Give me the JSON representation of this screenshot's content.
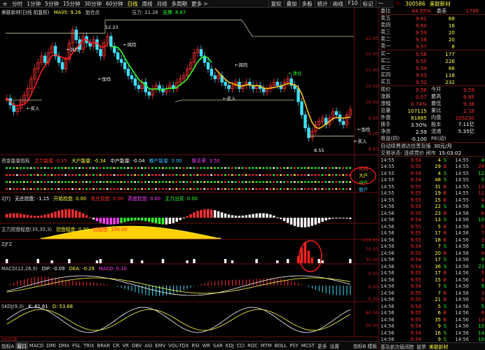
{
  "topbar": {
    "tabs": [
      "分时",
      "1分钟",
      "5分钟",
      "15分钟",
      "30分钟",
      "60分钟",
      "日线",
      "周线",
      "月线",
      "多周期",
      "更多 >"
    ],
    "selected": "日线",
    "right": [
      "复权",
      "叠加",
      "多股",
      "统计",
      "画线",
      "F10",
      "标记",
      "—"
    ],
    "icons": [
      "grid-icon",
      "lock-icon",
      "more-icon"
    ]
  },
  "stock": {
    "code": "300586",
    "name": "美联新材"
  },
  "main": {
    "title": "美联新材(日线 前复权)",
    "ma": "MA05: 9.26",
    "pressure": "压力: 11.26",
    "support": "支撑: 8.67",
    "addpoint": "加仓点",
    "price_labels": [
      "12.00",
      "11.50",
      "11.00",
      "10.50",
      "10.00",
      "9.50",
      "9.00",
      "8.50"
    ],
    "annotations": {
      "high": "12.23",
      "low": "8.55",
      "risk1": "←风险",
      "risk2": "←风险",
      "risk3": "←风险",
      "add1": "←加仓",
      "add2": "←加仓",
      "buy1": "←买入",
      "buy2": "←买入",
      "buy3": "←买入",
      "clear": "←清仓"
    }
  },
  "p1": {
    "title": "资金能量指标",
    "a": "主力能量: 0.15",
    "b": "大户能量: -0.34",
    "c": "中户能量: -0.04",
    "d": "散户能量: 0.00",
    "e": "换手率: 3.50",
    "labels": [
      "机构",
      "大户",
      "中户",
      "散户"
    ]
  },
  "p2": {
    "title": "ZJTJ",
    "a": "无庄控盘: -1.15",
    "b": "开始控盘: 0.00",
    "c": "有庄控盘: 0.00",
    "d": "高度控盘: 0.00",
    "e": "主力出货: 0.00"
  },
  "p3": {
    "title": "主力控盘程度(35,35,3)",
    "a": "控盘程度: 0.00",
    "b": "控盘度: 100.00",
    "axis": [
      "-150.00"
    ]
  },
  "p4": {
    "title": "ZJFZ",
    "axis": [
      "70.00",
      "35.00"
    ]
  },
  "p5": {
    "title": "MACD(12,26,9)",
    "a": "DIF: -0.09",
    "b": "DEA: -0.29",
    "c": "MACD: 0.10",
    "axis": [
      "0.50",
      "0.00",
      "-0.50"
    ]
  },
  "p6": {
    "title": "SKDJ(9,3)",
    "a": "K: 61.61",
    "b": "D: 53.68",
    "axis": [
      "80.00",
      "50.00"
    ]
  },
  "bottom": {
    "date": "2025年",
    "tabs": [
      "指标A",
      "窗口",
      "MACD",
      "DMI",
      "DMA",
      "FSL",
      "TRIX",
      "BRAR",
      "CR",
      "VR",
      "OBV",
      "ASI",
      "EMV",
      "VOL-TDX",
      "RSI",
      "WR",
      "SAR",
      "KDJ",
      "CCI",
      "ROC",
      "MTM",
      "BOLL",
      "PSY",
      "MCST",
      "更多",
      "设置"
    ],
    "right": "指标B 模板"
  },
  "order": {
    "weibi": "委比",
    "weibi_v": "64.55%",
    "weicha": "委差",
    "weicha_v": "1799",
    "sells": [
      [
        "卖五",
        "9.61",
        "68"
      ],
      [
        "卖四",
        "9.60",
        "16"
      ],
      [
        "卖三",
        "9.59",
        "20"
      ],
      [
        "卖二",
        "9.58",
        "20"
      ],
      [
        "卖一",
        "9.57",
        "8"
      ]
    ],
    "buys": [
      [
        "买一",
        "9.56",
        "177"
      ],
      [
        "买二",
        "9.55",
        "226"
      ],
      [
        "买三",
        "9.54",
        "66"
      ],
      [
        "买四",
        "9.53",
        "118"
      ],
      [
        "买五",
        "9.52",
        "232"
      ]
    ]
  },
  "quote": [
    [
      "现价",
      "9.56",
      "今开",
      "9.59"
    ],
    [
      "涨跌",
      "0.07",
      "最高",
      "9.85"
    ],
    [
      "涨幅",
      "0.74%",
      "最低",
      "9.38"
    ],
    [
      "总量",
      "107115",
      "量比",
      "2.16"
    ],
    [
      "外盘",
      "81885",
      "内盘",
      "105230"
    ],
    [
      "换手",
      "3.50%",
      "股本",
      "7.11亿"
    ],
    [
      "净资",
      "2.59",
      "流通",
      "5.35亿"
    ],
    [
      "收益(四)",
      "-0.100",
      "PE(动)",
      ""
    ]
  ],
  "flags": {
    "auto": "自动续费通达信普及版",
    "price": "30元/月",
    "status": "交易状态: 连续竞价 闭市",
    "time": "15:03:02"
  },
  "ticks": [
    [
      "14:55",
      "9.54",
      "4",
      "4"
    ],
    [
      "14:55",
      "9.55",
      "29",
      "29"
    ],
    [
      "14:55",
      "9.54",
      "4",
      "12"
    ],
    [
      "14:55",
      "9.54",
      "48",
      "5"
    ],
    [
      "14:55",
      "9.55",
      "31",
      "13"
    ],
    [
      "14:55",
      "9.55",
      "19",
      "11"
    ],
    [
      "14:55",
      "9.55",
      "15",
      "4"
    ],
    [
      "14:56",
      "9.54",
      "22",
      "6"
    ],
    [
      "14:56",
      "9.55",
      "23",
      "6"
    ],
    [
      "14:56",
      "9.54",
      "13",
      "10"
    ],
    [
      "14:56",
      "9.55",
      "5",
      "5"
    ],
    [
      "14:56",
      "9.55",
      "17",
      "7"
    ],
    [
      "14:56",
      "9.55",
      "18",
      "3"
    ],
    [
      "14:56",
      "9.54",
      "7",
      "5"
    ],
    [
      "14:56",
      "9.55",
      "20",
      "9"
    ],
    [
      "14:56",
      "9.54",
      "17",
      "9"
    ],
    [
      "14:56",
      "9.54",
      "36",
      "23"
    ],
    [
      "14:56",
      "9.55",
      "17",
      "5"
    ],
    [
      "14:56",
      "9.55",
      "15",
      "4"
    ],
    [
      "14:56",
      "9.54",
      "7",
      "9"
    ],
    [
      "14:56",
      "9.55",
      "7",
      "3"
    ],
    [
      "14:56",
      "9.55",
      "21",
      "5"
    ],
    [
      "14:56",
      "9.54",
      "5",
      "5"
    ],
    [
      "14:56",
      "9.55",
      "6",
      "6"
    ],
    [
      "14:56",
      "9.55",
      "35",
      "13"
    ],
    [
      "14:56",
      "9.54",
      "9",
      "10"
    ],
    [
      "14:56",
      "9.54",
      "16",
      "14"
    ],
    [
      "14:56",
      "9.54",
      "9",
      "10"
    ],
    [
      "14:56",
      "9.55",
      "4",
      "8"
    ],
    [
      "14:56",
      "9.56",
      "2274",
      "0"
    ]
  ],
  "foot": {
    "a": "基及新次级闭跨",
    "b": "股票",
    "c": "美联新材"
  }
}
